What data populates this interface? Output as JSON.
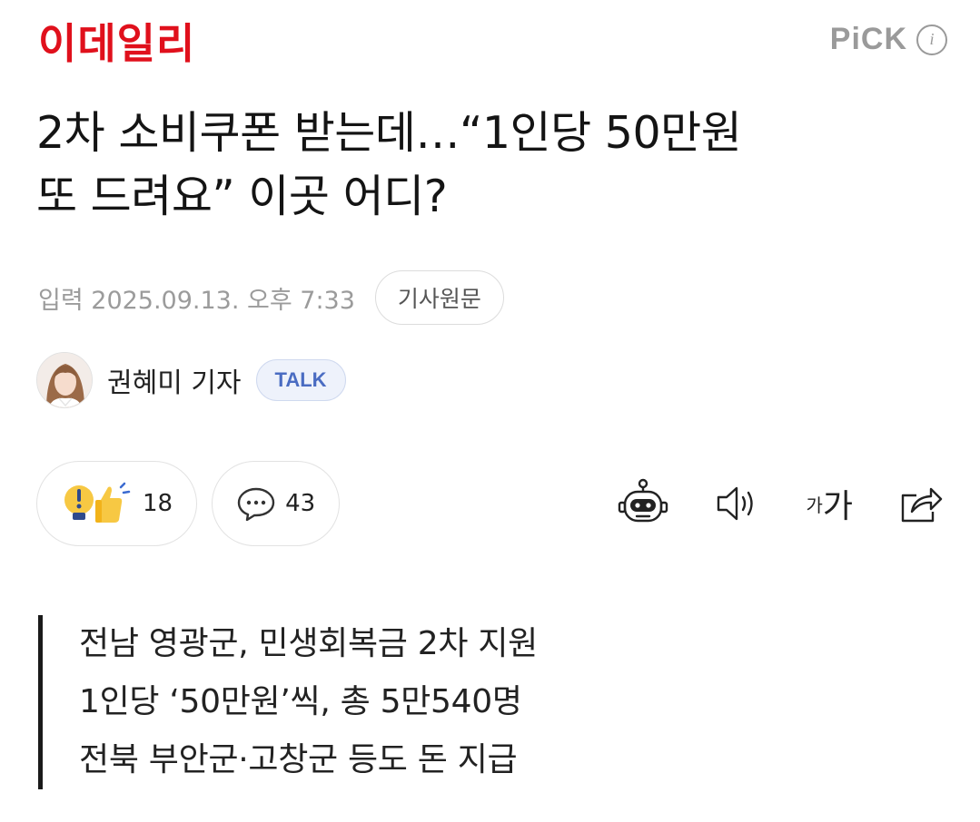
{
  "header": {
    "logo_text": "이데일리",
    "pick_label": "PiCK",
    "info_icon": "info-icon"
  },
  "article": {
    "title_line1": "2차 소비쿠폰 받는데…“1인당 50만원",
    "title_line2": "또 드려요” 이곳 어디?",
    "published": "입력 2025.09.13. 오후 7:33",
    "origin_button": "기사원문"
  },
  "reporter": {
    "name": "권혜미 기자",
    "talk_label": "TALK"
  },
  "reactions": {
    "like_count": "18",
    "comment_count": "43"
  },
  "tools": {
    "summary_bot_icon": "robot-icon",
    "tts_icon": "speaker-icon",
    "font_small": "가",
    "font_large": "가",
    "share_icon": "share-icon"
  },
  "summary": [
    "전남 영광군, 민생회복금 2차 지원",
    "1인당 ‘50만원’씩, 총 5만540명",
    "전북 부안군·고창군 등도 돈 지급"
  ],
  "colors": {
    "brand_red": "#e0101c",
    "talk_blue": "#4a6cc2",
    "meta_gray": "#9b9b9b"
  }
}
